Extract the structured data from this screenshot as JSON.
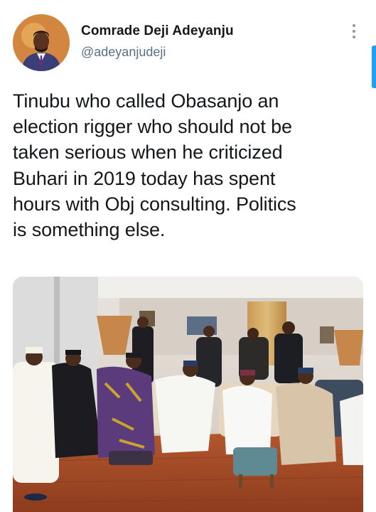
{
  "author": {
    "display_name": "Comrade Deji Adeyanju",
    "handle": "@adeyanjudeji",
    "avatar_icon": "profile-photo"
  },
  "tweet": {
    "text": "Tinubu who called Obasanjo an\nelection rigger who should  not be\ntaken serious when he criticized\nBuhari in 2019 today has spent\nhours with Obj consulting. Politics\nis something else."
  },
  "media": {
    "type": "photo",
    "icon": "photo-attachment"
  },
  "actions": {
    "more_icon": "vertical-ellipsis-icon"
  },
  "colors": {
    "name": "#14171a",
    "handle": "#5b7083",
    "accent": "#1da1f2"
  }
}
